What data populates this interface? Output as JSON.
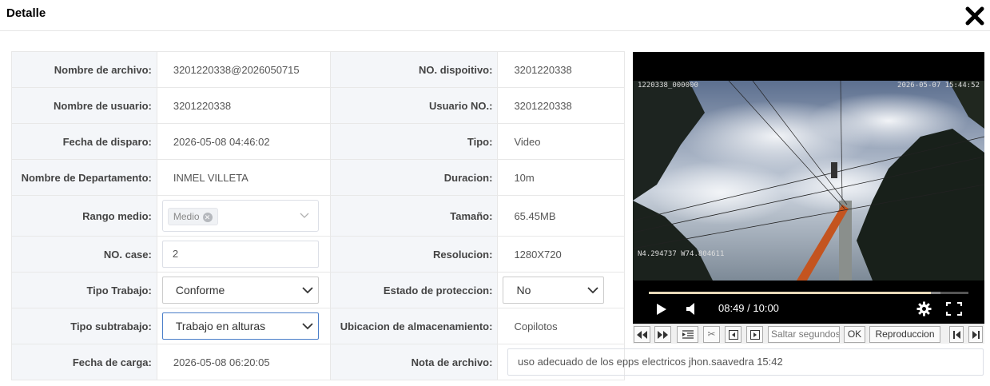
{
  "dialog": {
    "title": "Detalle",
    "close_icon": "close-icon"
  },
  "fields": {
    "nombre_archivo": {
      "label": "Nombre de archivo:",
      "value": "3201220338@2026050715"
    },
    "no_dispositivo": {
      "label": "NO. dispoitivo:",
      "value": "3201220338"
    },
    "nombre_usuario": {
      "label": "Nombre de usuario:",
      "value": "3201220338"
    },
    "usuario_no": {
      "label": "Usuario NO.:",
      "value": "3201220338"
    },
    "fecha_disparo": {
      "label": "Fecha de disparo:",
      "value": "2026-05-08 04:46:02"
    },
    "tipo": {
      "label": "Tipo:",
      "value": "Video"
    },
    "departamento": {
      "label": "Nombre de Departamento:",
      "value": "INMEL VILLETA"
    },
    "duracion": {
      "label": "Duracion:",
      "value": "10m"
    },
    "rango_medio": {
      "label": "Rango medio:",
      "tag": "Medio"
    },
    "tamano": {
      "label": "Tamaño:",
      "value": "65.45MB"
    },
    "no_case": {
      "label": "NO. case:",
      "value": "2"
    },
    "resolucion": {
      "label": "Resolucion:",
      "value": "1280X720"
    },
    "tipo_trabajo": {
      "label": "Tipo Trabajo:",
      "value": "Conforme"
    },
    "estado_proteccion": {
      "label": "Estado de proteccion:",
      "value": "No"
    },
    "tipo_subtrabajo": {
      "label": "Tipo subtrabajo:",
      "value": "Trabajo en alturas"
    },
    "ubicacion": {
      "label": "Ubicacion de almacenamiento:",
      "value": "Copilotos"
    },
    "fecha_carga": {
      "label": "Fecha de carga:",
      "value": "2026-05-08 06:20:05"
    },
    "nota_archivo": {
      "label": "Nota de archivo:",
      "value": "uso adecuado de los epps electricos jhon.saavedra 15:42"
    }
  },
  "video": {
    "osd_top_left": "1220338_000000",
    "osd_top_right": "2026-05-07 15:44:52",
    "osd_bottom_left": "N4.294737 W74.804611",
    "timecode": "08:49 / 10:00",
    "progress_fraction": 0.882,
    "buffered_fraction": 0.913
  },
  "toolbar": {
    "seek_placeholder": "Saltar segundos",
    "ok_label": "OK",
    "playback_label": "Reproduccion"
  }
}
